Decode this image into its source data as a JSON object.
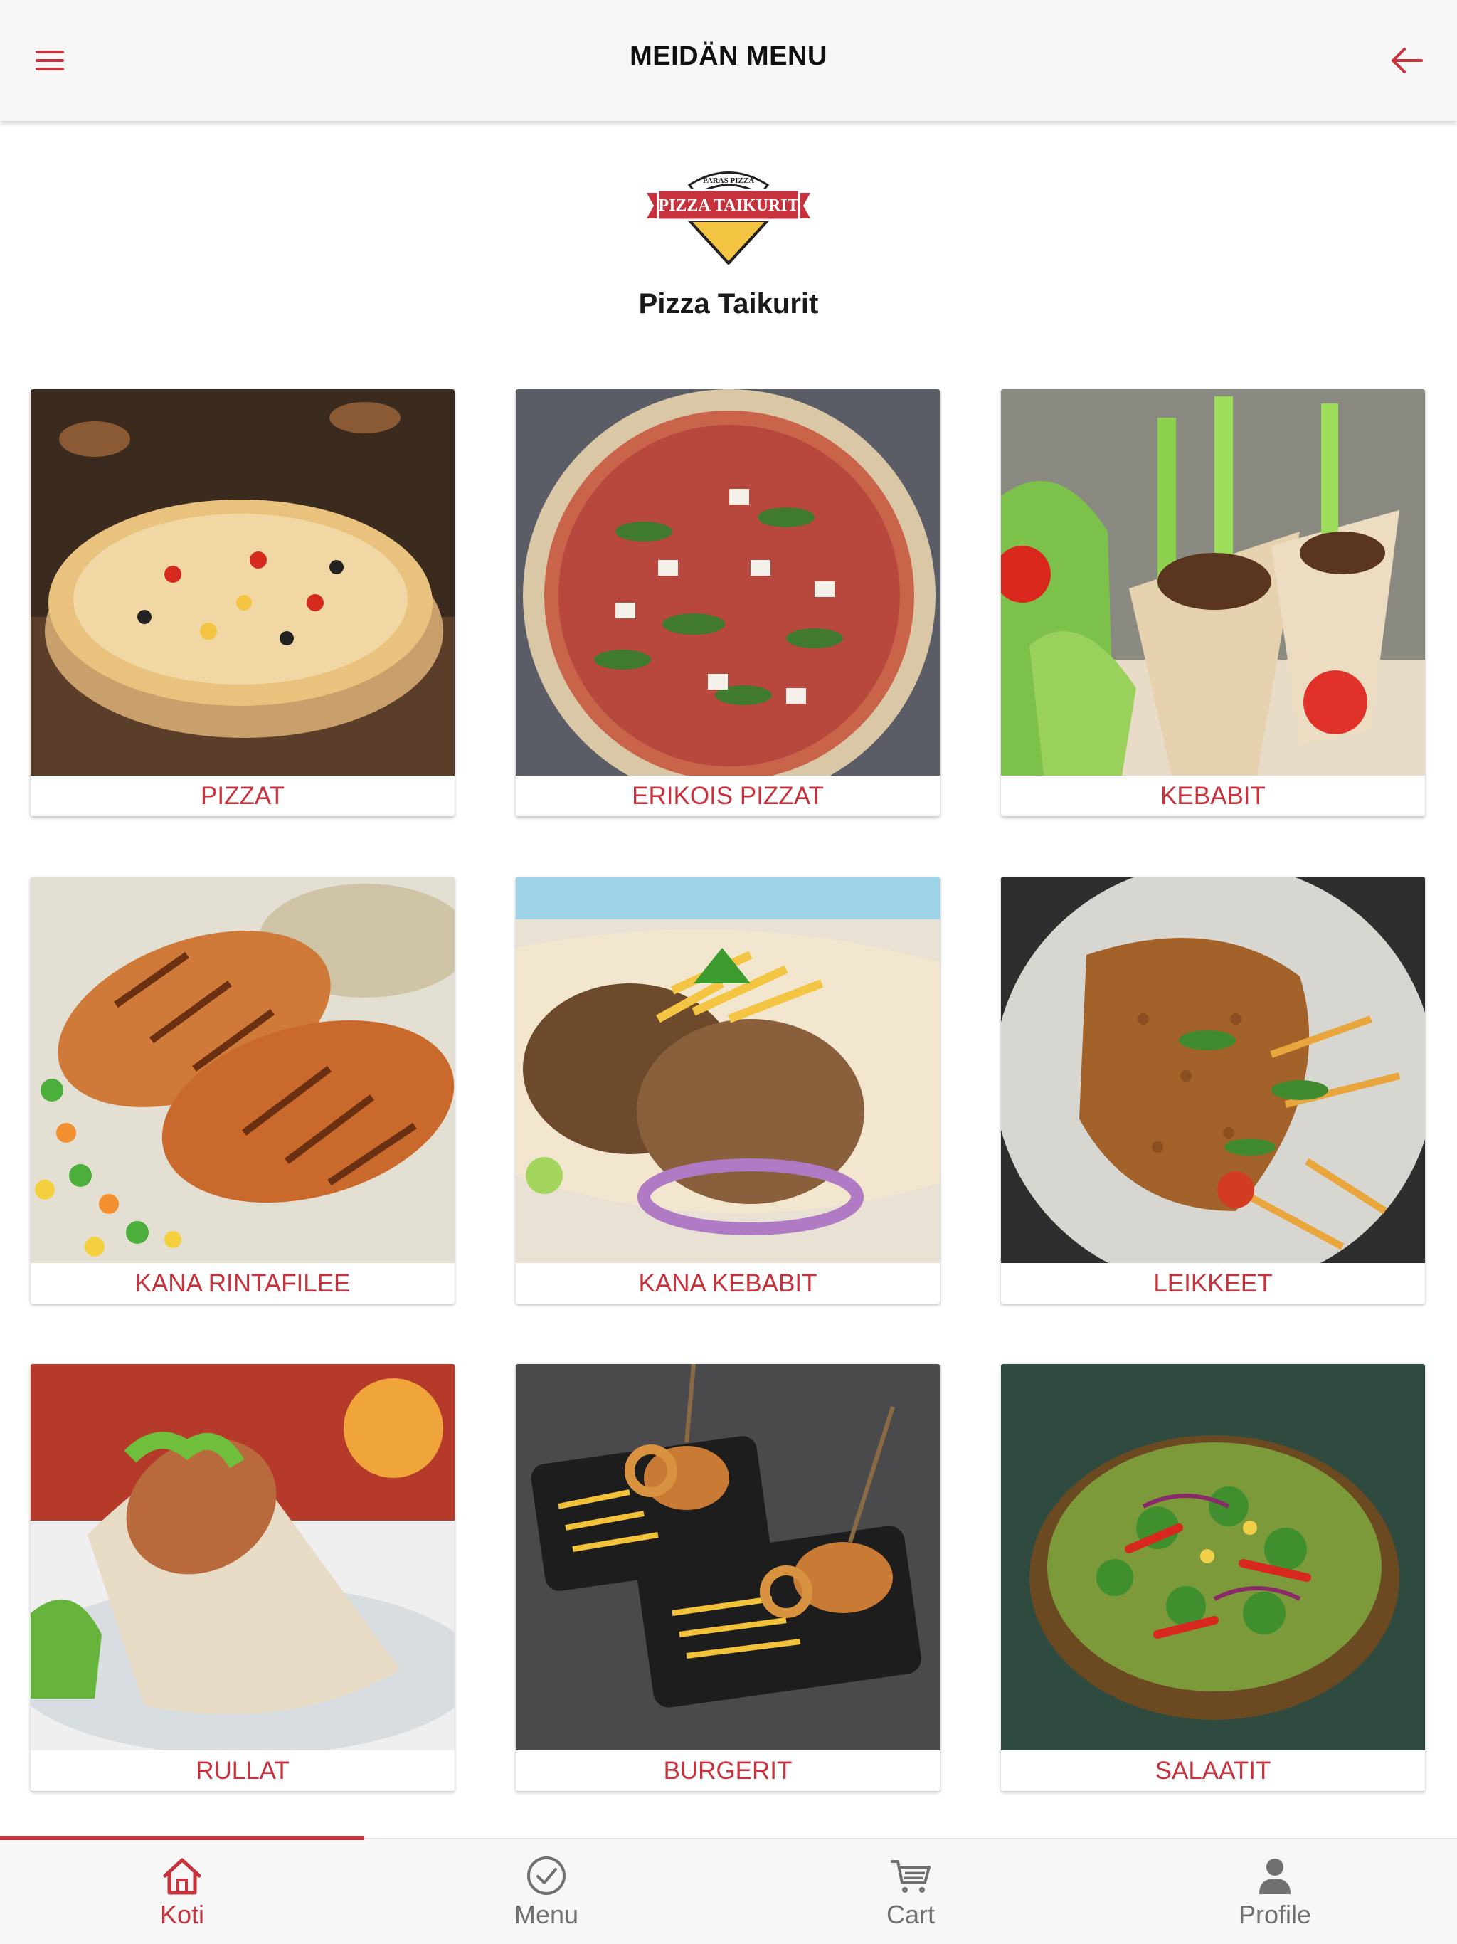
{
  "header": {
    "title": "MEIDÄN MENU",
    "menu_icon": "hamburger-menu-icon",
    "back_icon": "arrow-left-icon"
  },
  "restaurant": {
    "name": "Pizza Taikurit",
    "logo": {
      "top_text": "PARAS PIZZA",
      "banner_text": "PIZZA TAIKURIT"
    }
  },
  "categories": [
    {
      "label": "PIZZAT"
    },
    {
      "label": "ERIKOIS PIZZAT"
    },
    {
      "label": "KEBABIT"
    },
    {
      "label": "KANA RINTAFILEE"
    },
    {
      "label": "KANA KEBABIT"
    },
    {
      "label": "LEIKKEET"
    },
    {
      "label": "RULLAT"
    },
    {
      "label": "BURGERIT"
    },
    {
      "label": "SALAATIT"
    }
  ],
  "bottom_nav": {
    "active_tab": "Koti",
    "tabs": [
      {
        "label": "Koti",
        "icon": "home-icon"
      },
      {
        "label": "Menu",
        "icon": "check-circle-icon"
      },
      {
        "label": "Cart",
        "icon": "cart-icon"
      },
      {
        "label": "Profile",
        "icon": "person-icon"
      }
    ]
  },
  "colors": {
    "accent": "#c8323c",
    "bar_background": "#f7f7f7",
    "label_text": "#c8323c"
  }
}
